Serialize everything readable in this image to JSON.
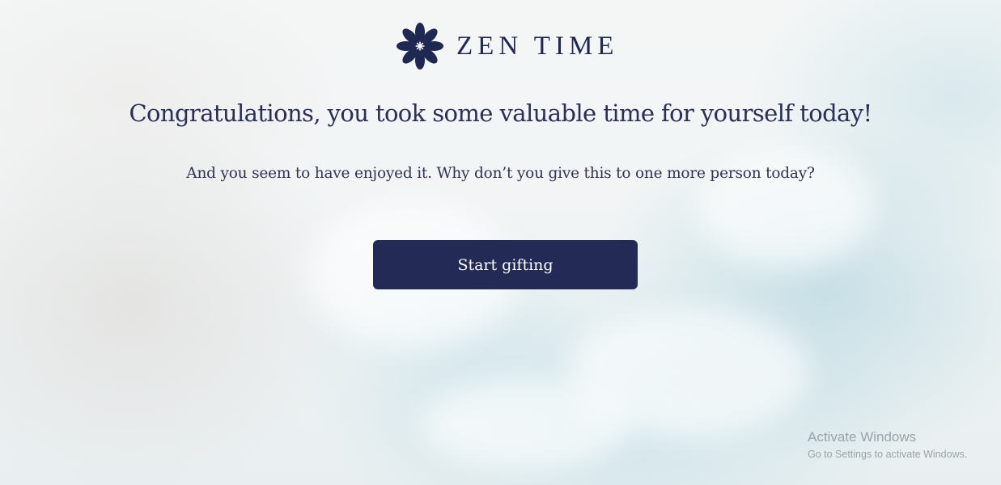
{
  "brand": {
    "name": "ZEN TIME",
    "logo_icon": "lotus-flower-icon",
    "color": "#1f2850"
  },
  "main": {
    "headline": "Congratulations, you took some valuable time for yourself today!",
    "subtext": "And you seem to have enjoyed it. Why don’t you give this to one more person today?",
    "cta_label": "Start gifting",
    "cta_color": "#232a55"
  },
  "watermark": {
    "title": "Activate Windows",
    "subtitle": "Go to Settings to activate Windows."
  }
}
